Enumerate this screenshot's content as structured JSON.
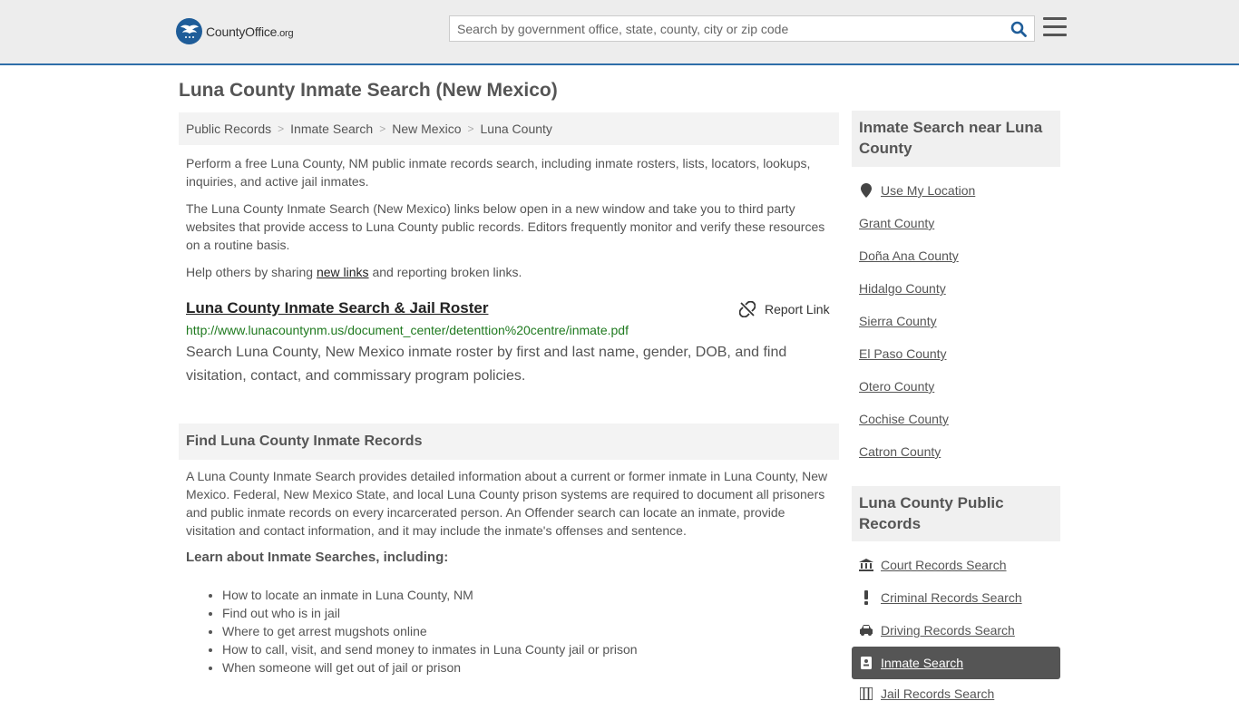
{
  "header": {
    "logo_main": "CountyOffice",
    "logo_org": ".org",
    "search_placeholder": "Search by government office, state, county, city or zip code"
  },
  "page_title": "Luna County Inmate Search (New Mexico)",
  "breadcrumb": [
    "Public Records",
    "Inmate Search",
    "New Mexico",
    "Luna County"
  ],
  "intro": {
    "p1": "Perform a free Luna County, NM public inmate records search, including inmate rosters, lists, locators, lookups, inquiries, and active jail inmates.",
    "p2": "The Luna County Inmate Search (New Mexico) links below open in a new window and take you to third party websites that provide access to Luna County public records. Editors frequently monitor and verify these resources on a routine basis.",
    "p3_before": "Help others by sharing ",
    "p3_link": "new links",
    "p3_after": " and reporting broken links."
  },
  "result": {
    "title": "Luna County Inmate Search & Jail Roster",
    "report_label": "Report Link",
    "url": "http://www.lunacountynm.us/document_center/detenttion%20centre/inmate.pdf",
    "description": "Search Luna County, New Mexico inmate roster by first and last name, gender, DOB, and find visitation, contact, and commissary program policies."
  },
  "find_section": {
    "heading": "Find Luna County Inmate Records",
    "body": "A Luna County Inmate Search provides detailed information about a current or former inmate in Luna County, New Mexico. Federal, New Mexico State, and local Luna County prison systems are required to document all prisoners and public inmate records on every incarcerated person. An Offender search can locate an inmate, provide visitation and contact information, and it may include the inmate's offenses and sentence.",
    "learn_heading": "Learn about Inmate Searches, including:",
    "learn_items": [
      "How to locate an inmate in Luna County, NM",
      "Find out who is in jail",
      "Where to get arrest mugshots online",
      "How to call, visit, and send money to inmates in Luna County jail or prison",
      "When someone will get out of jail or prison"
    ]
  },
  "sidebar": {
    "nearby_heading": "Inmate Search near Luna County",
    "use_location": "Use My Location",
    "nearby": [
      "Grant County",
      "Doña Ana County",
      "Hidalgo County",
      "Sierra County",
      "El Paso County",
      "Otero County",
      "Cochise County",
      "Catron County"
    ],
    "records_heading": "Luna County Public Records",
    "records": [
      {
        "label": "Court Records Search",
        "icon": "courthouse-icon"
      },
      {
        "label": "Criminal Records Search",
        "icon": "exclamation-icon"
      },
      {
        "label": "Driving Records Search",
        "icon": "car-icon"
      },
      {
        "label": "Inmate Search",
        "icon": "id-card-icon"
      },
      {
        "label": "Jail Records Search",
        "icon": "jail-icon"
      }
    ]
  }
}
